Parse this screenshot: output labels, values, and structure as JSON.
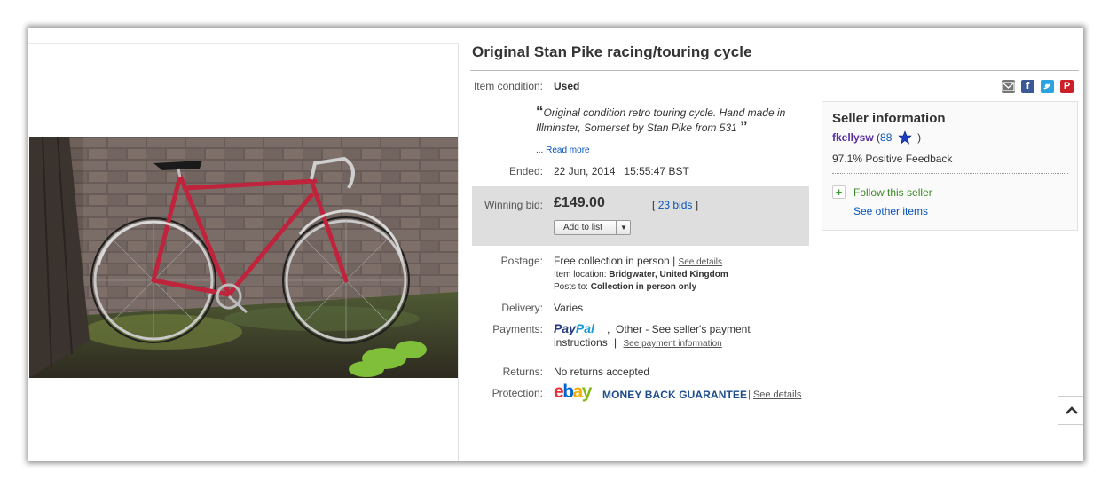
{
  "listing": {
    "title": "Original Stan Pike racing/touring cycle",
    "condition_label": "Item condition:",
    "condition_value": "Used",
    "quote_open": "“",
    "description": "Original condition retro touring cycle. Hand made in Illminster, Somerset by Stan Pike from 531",
    "quote_close": "”",
    "read_more_prefix": "...",
    "read_more": "Read more",
    "ended_label": "Ended:",
    "ended_value": "22 Jun, 2014   15:55:47 BST"
  },
  "bid": {
    "label": "Winning bid:",
    "price": "£149.00",
    "count_open": "[",
    "count": "23 bids",
    "count_close": "]",
    "add_to_list": "Add to list"
  },
  "postage": {
    "label": "Postage:",
    "value": "Free collection in person",
    "sep": "|",
    "see_details": "See details",
    "location_label": "Item location:",
    "location_value": "Bridgwater, United Kingdom",
    "posts_to_label": "Posts to:",
    "posts_to_value": "Collection in person only"
  },
  "delivery": {
    "label": "Delivery:",
    "value": "Varies"
  },
  "payments": {
    "label": "Payments:",
    "paypal_1": "Pay",
    "paypal_2": "Pal",
    "value": ",  Other - See seller's payment",
    "value2": "instructions",
    "sep": "|",
    "link": "See payment information"
  },
  "returns": {
    "label": "Returns:",
    "value": "No returns accepted"
  },
  "protection": {
    "label": "Protection:",
    "ebay_e": "e",
    "ebay_b": "b",
    "ebay_a": "a",
    "ebay_y": "y",
    "guarantee": "MONEY BACK GUARANTEE",
    "sep": "|",
    "see_details": "See details"
  },
  "seller": {
    "title": "Seller information",
    "name": "fkellysw",
    "score_open": "(",
    "score": "88",
    "score_close": ")",
    "feedback": "97.1% Positive Feedback",
    "follow": "Follow this seller",
    "see_other": "See other items"
  },
  "share_icons": [
    "email-icon",
    "facebook-icon",
    "twitter-icon",
    "pinterest-icon"
  ],
  "colors": {
    "link": "#0654ba",
    "seller_name": "#5a2fa0",
    "bid_box": "#dedede",
    "bike_frame": "#c0243c",
    "paypal_dark": "#253b80",
    "paypal_light": "#179bd7",
    "ebay_red": "#e53238",
    "ebay_blue": "#0064d2",
    "ebay_yellow": "#f5af02",
    "ebay_green": "#86b817"
  }
}
